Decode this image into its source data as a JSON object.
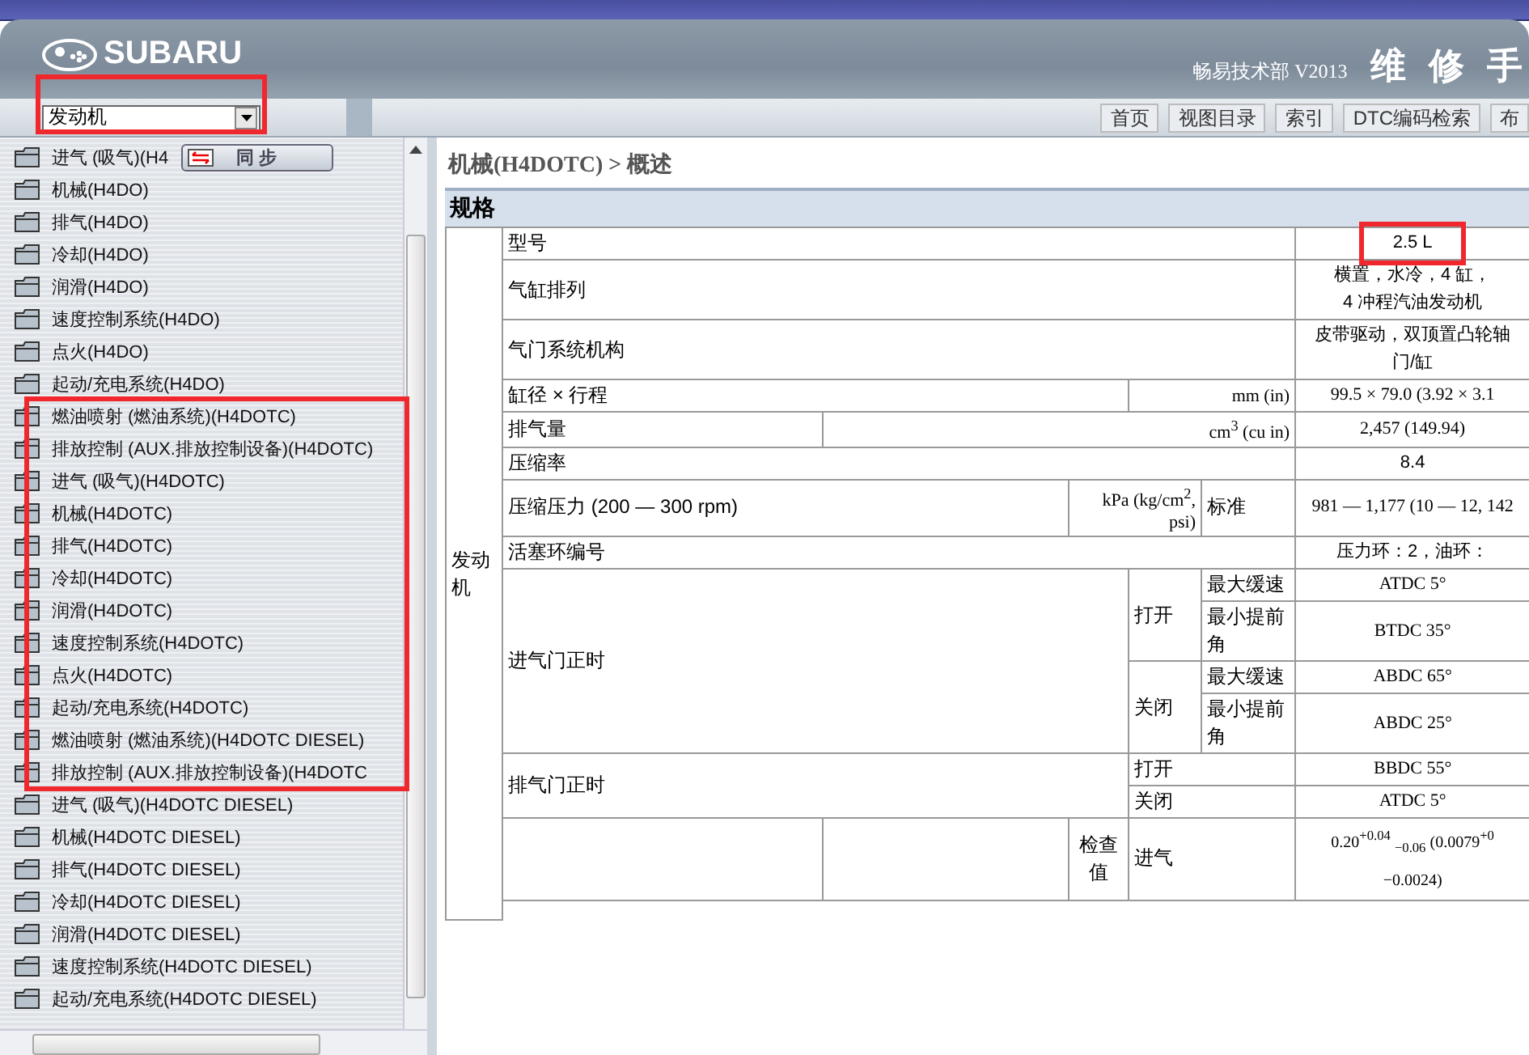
{
  "header": {
    "brand": "SUBARU",
    "publisher": "畅易技术部 V2013",
    "title": "维 修 手"
  },
  "selector": {
    "value": "发动机",
    "highlighted": true
  },
  "nav": [
    "首页",
    "视图目录",
    "索引",
    "DTC编码检索",
    "布"
  ],
  "sync_button": {
    "label": "同 步"
  },
  "sidebar": {
    "items": [
      {
        "label": "进气 (吸气)(H4",
        "highlighted": false
      },
      {
        "label": "机械(H4DO)",
        "highlighted": false
      },
      {
        "label": "排气(H4DO)",
        "highlighted": false
      },
      {
        "label": "冷却(H4DO)",
        "highlighted": false
      },
      {
        "label": "润滑(H4DO)",
        "highlighted": false
      },
      {
        "label": "速度控制系统(H4DO)",
        "highlighted": false
      },
      {
        "label": "点火(H4DO)",
        "highlighted": false
      },
      {
        "label": "起动/充电系统(H4DO)",
        "highlighted": false
      },
      {
        "label": "燃油喷射 (燃油系统)(H4DOTC)",
        "highlighted": true
      },
      {
        "label": "排放控制 (AUX.排放控制设备)(H4DOTC)",
        "highlighted": true
      },
      {
        "label": "进气 (吸气)(H4DOTC)",
        "highlighted": true
      },
      {
        "label": "机械(H4DOTC)",
        "highlighted": true
      },
      {
        "label": "排气(H4DOTC)",
        "highlighted": true
      },
      {
        "label": "冷却(H4DOTC)",
        "highlighted": true
      },
      {
        "label": "润滑(H4DOTC)",
        "highlighted": true
      },
      {
        "label": "速度控制系统(H4DOTC)",
        "highlighted": true
      },
      {
        "label": "点火(H4DOTC)",
        "highlighted": true
      },
      {
        "label": "起动/充电系统(H4DOTC)",
        "highlighted": true
      },
      {
        "label": "燃油喷射 (燃油系统)(H4DOTC DIESEL)",
        "highlighted": true
      },
      {
        "label": "排放控制 (AUX.排放控制设备)(H4DOTC",
        "highlighted": true
      },
      {
        "label": "进气 (吸气)(H4DOTC DIESEL)",
        "highlighted": false
      },
      {
        "label": "机械(H4DOTC DIESEL)",
        "highlighted": false
      },
      {
        "label": "排气(H4DOTC DIESEL)",
        "highlighted": false
      },
      {
        "label": "冷却(H4DOTC DIESEL)",
        "highlighted": false
      },
      {
        "label": "润滑(H4DOTC DIESEL)",
        "highlighted": false
      },
      {
        "label": "速度控制系统(H4DOTC DIESEL)",
        "highlighted": false
      },
      {
        "label": "起动/充电系统(H4DOTC DIESEL)",
        "highlighted": false
      }
    ]
  },
  "breadcrumb": "机械(H4DOTC) > 概述",
  "section_title": "规格",
  "table": {
    "group": "发动机",
    "rows": [
      {
        "kind": "simple",
        "label": "型号",
        "lines": [
          "2.5 L"
        ],
        "highlighted": true
      },
      {
        "kind": "simple",
        "label": "气缸排列",
        "lines": [
          "横置，水冷，4 缸，",
          "4 冲程汽油发动机"
        ],
        "highlighted": false
      },
      {
        "kind": "simple",
        "label": "气门系统机构",
        "lines": [
          "皮带驱动，双顶置凸轮轴",
          "门/缸"
        ],
        "highlighted": false
      },
      {
        "kind": "unit_short",
        "label": "缸径 × 行程",
        "unit": "mm (in)",
        "value": "99.5 × 79.0 (3.92 × 3.1"
      },
      {
        "kind": "unit_long",
        "label": "排气量",
        "unit": "cm$^{3}$ (cu in)",
        "value": "2,457 (149.94)"
      },
      {
        "kind": "simple",
        "label": "压缩率",
        "lines": [
          "8.4"
        ],
        "highlighted": false
      },
      {
        "kind": "pressure",
        "label": "压缩压力 (200 — 300 rpm)",
        "unit": "kPa (kg/cm$^{2}$, psi)",
        "condition": "标准",
        "value": "981 — 1,177 (10 — 12, 142"
      },
      {
        "kind": "simple",
        "label": "活塞环编号",
        "lines": [
          "压力环：2，油环："
        ],
        "highlighted": false
      },
      {
        "kind": "timing",
        "label": "进气门正时",
        "groups": [
          {
            "label": "打开",
            "entries": [
              {
                "label": "最大缓速",
                "value": "ATDC 5°"
              },
              {
                "label": "最小提前角",
                "value": "BTDC 35°"
              }
            ]
          },
          {
            "label": "关闭",
            "entries": [
              {
                "label": "最大缓速",
                "value": "ABDC 65°"
              },
              {
                "label": "最小提前角",
                "value": "ABDC 25°"
              }
            ]
          }
        ]
      },
      {
        "kind": "timing_simple",
        "label": "排气门正时",
        "entries": [
          {
            "label": "打开",
            "value": "BBDC 55°"
          },
          {
            "label": "关闭",
            "value": "ATDC 5°"
          }
        ]
      },
      {
        "kind": "check",
        "label": "检查值",
        "entries": [
          {
            "label": "进气",
            "value": "0.20$^{+0.04}$ $_{−0.06}$ (0.0079$^{+0}$ −0.0024)"
          }
        ]
      }
    ]
  }
}
